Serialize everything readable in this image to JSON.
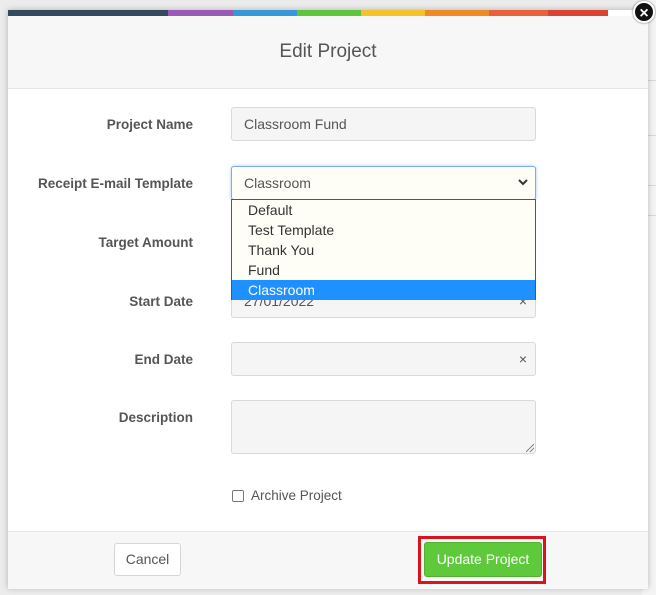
{
  "modal": {
    "title": "Edit Project",
    "close_glyph": "×",
    "accent_colors": [
      "#34495e",
      "#9b59b6",
      "#3498db",
      "#5fc53b",
      "#f6c22b",
      "#f08a24",
      "#e8603c",
      "#d94332"
    ]
  },
  "form": {
    "project_name": {
      "label": "Project Name",
      "value": "Classroom Fund"
    },
    "receipt_template": {
      "label": "Receipt E-mail Template",
      "value": "Classroom",
      "options": [
        "Default",
        "Test Template",
        "Thank You",
        "Fund",
        "Classroom"
      ],
      "selected_index": 4
    },
    "target_amount": {
      "label": "Target Amount",
      "value": ""
    },
    "start_date": {
      "label": "Start Date",
      "value": "27/01/2022"
    },
    "end_date": {
      "label": "End Date",
      "value": ""
    },
    "description": {
      "label": "Description",
      "value": ""
    },
    "archive": {
      "label": "Archive Project",
      "checked": false
    }
  },
  "footer": {
    "cancel_label": "Cancel",
    "update_label": "Update Project",
    "highlight_color": "#d9141f",
    "update_color": "#5dc93b"
  },
  "icons": {
    "clear_glyph": "×",
    "chevron_glyph": "⌄"
  }
}
